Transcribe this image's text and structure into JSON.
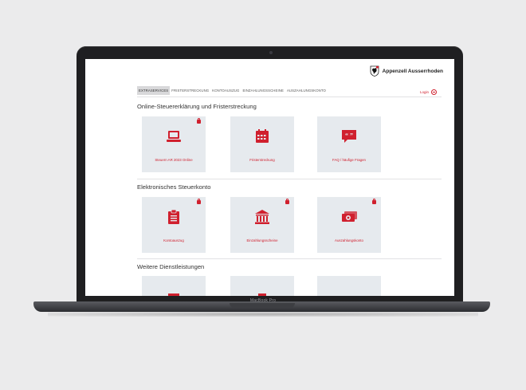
{
  "laptop": {
    "model_label": "MacBook Pro"
  },
  "brand": {
    "name": "Appenzell Ausserrhoden"
  },
  "nav": {
    "items": [
      {
        "label": "EXTRASERVICES"
      },
      {
        "label": "FRISTERSTRECKUNG"
      },
      {
        "label": "KONTOAUSZUG"
      },
      {
        "label": "EINZAHLUNGSSCHEINE"
      },
      {
        "label": "AUSZAHLUNGSKONTO"
      }
    ],
    "login_label": "Login"
  },
  "sections": [
    {
      "title": "Online-Steuererklärung und Fristerstreckung",
      "tiles": [
        {
          "label": "Steuern AR 2023 Online",
          "icon": "laptop-icon",
          "locked": true
        },
        {
          "label": "Fristerstreckung",
          "icon": "calendar-icon",
          "locked": false
        },
        {
          "label": "FAQ / häufige Fragen",
          "icon": "quote-bubble-icon",
          "locked": false
        }
      ]
    },
    {
      "title": "Elektronisches Steuerkonto",
      "tiles": [
        {
          "label": "Kontoauszug",
          "icon": "clipboard-icon",
          "locked": true
        },
        {
          "label": "Einzahlungsscheine",
          "icon": "bank-icon",
          "locked": true
        },
        {
          "label": "Auszahlungskonto",
          "icon": "money-icon",
          "locked": true
        }
      ]
    },
    {
      "title": "Weitere Dienstleistungen",
      "tiles": []
    }
  ],
  "colors": {
    "accent": "#d0202e",
    "tile_bg": "#e6eaee"
  }
}
